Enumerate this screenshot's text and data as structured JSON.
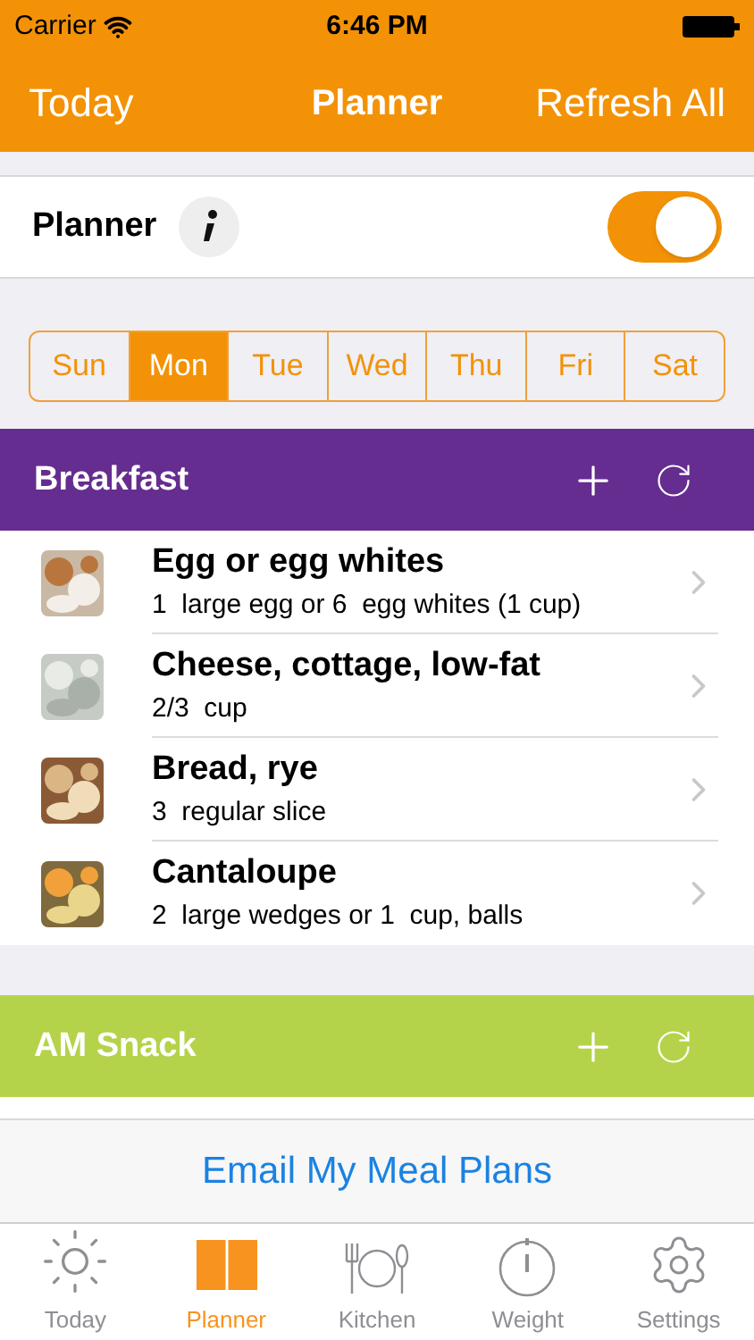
{
  "status_bar": {
    "carrier": "Carrier",
    "time": "6:46 PM"
  },
  "nav": {
    "left": "Today",
    "title": "Planner",
    "right": "Refresh All"
  },
  "planner": {
    "label": "Planner",
    "on": true
  },
  "days": [
    {
      "label": "Sun",
      "selected": false
    },
    {
      "label": "Mon",
      "selected": true
    },
    {
      "label": "Tue",
      "selected": false
    },
    {
      "label": "Wed",
      "selected": false
    },
    {
      "label": "Thu",
      "selected": false
    },
    {
      "label": "Fri",
      "selected": false
    },
    {
      "label": "Sat",
      "selected": false
    }
  ],
  "meals": [
    {
      "title": "Breakfast",
      "color": "#652d90",
      "items": [
        {
          "name": "Egg or egg whites",
          "amount": "1  large egg or 6  egg whites (1 cup)"
        },
        {
          "name": "Cheese, cottage, low-fat",
          "amount": "2/3  cup"
        },
        {
          "name": "Bread, rye",
          "amount": "3  regular slice"
        },
        {
          "name": "Cantaloupe",
          "amount": "2  large wedges or 1  cup, balls"
        }
      ]
    },
    {
      "title": "AM Snack",
      "color": "#b5d34a"
    }
  ],
  "email_button": "Email My Meal Plans",
  "tabs": [
    {
      "label": "Today",
      "selected": false
    },
    {
      "label": "Planner",
      "selected": true
    },
    {
      "label": "Kitchen",
      "selected": false
    },
    {
      "label": "Weight",
      "selected": false
    },
    {
      "label": "Settings",
      "selected": false
    }
  ]
}
